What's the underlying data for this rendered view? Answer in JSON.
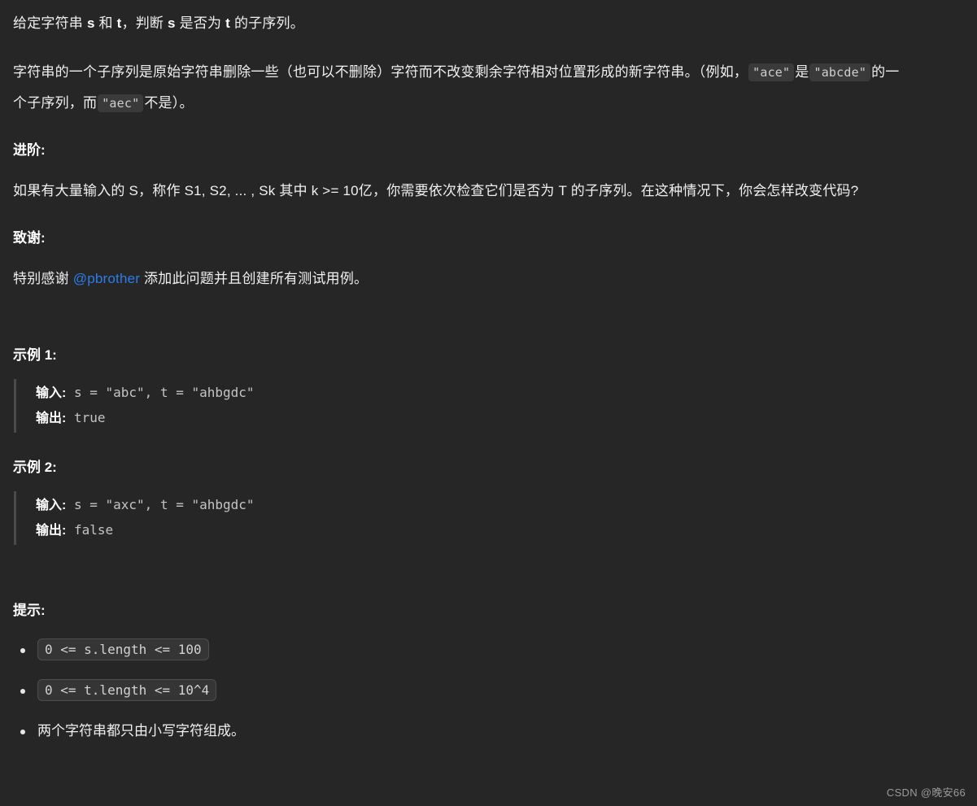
{
  "problem": {
    "statement_line1": {
      "seg1": "给定字符串 ",
      "s": "s",
      "seg2": " 和 ",
      "t": "t",
      "seg3": "，判断 ",
      "s2": "s",
      "seg4": " 是否为 ",
      "t2": "t",
      "seg5": " 的子序列。"
    },
    "statement_line2": {
      "seg1": "字符串的一个子序列是原始字符串删除一些（也可以不删除）字符而不改变剩余字符相对位置形成的新字符串。（例如，",
      "code_ace": "\"ace\"",
      "seg2": "是",
      "code_abcde": "\"abcde\"",
      "seg3": "的一个子序列，而",
      "code_aec": "\"aec\"",
      "seg4": "不是）。"
    }
  },
  "followup": {
    "heading": "进阶:",
    "text": "如果有大量输入的 S，称作 S1, S2, ... , Sk 其中 k >= 10亿，你需要依次检查它们是否为 T 的子序列。在这种情况下，你会怎样改变代码?"
  },
  "acknowledgement": {
    "heading": "致谢:",
    "prefix": "特别感谢 ",
    "link": "@pbrother",
    "suffix": " 添加此问题并且创建所有测试用例。"
  },
  "examples": [
    {
      "heading": "示例 1:",
      "input_label": "输入:",
      "input_value": " s = \"abc\", t = \"ahbgdc\"",
      "output_label": "输出:",
      "output_value": " true"
    },
    {
      "heading": "示例 2:",
      "input_label": "输入:",
      "input_value": " s = \"axc\", t = \"ahbgdc\"",
      "output_label": "输出:",
      "output_value": " false"
    }
  ],
  "hints": {
    "heading": "提示:",
    "items": [
      {
        "type": "code",
        "text": "0 <= s.length <= 100"
      },
      {
        "type": "code",
        "text": "0 <= t.length <= 10^4"
      },
      {
        "type": "text",
        "text": "两个字符串都只由小写字符组成。"
      }
    ]
  },
  "watermark": "CSDN @晚安66",
  "colors": {
    "background": "#262626",
    "text": "#f0f0f0",
    "link": "#2b7de9",
    "inline_code_bg": "#3a3a3a",
    "chip_bg": "#353535",
    "code_text": "#c4c4c4",
    "rule": "#4a4a4a",
    "watermark": "#9a9a9a"
  }
}
